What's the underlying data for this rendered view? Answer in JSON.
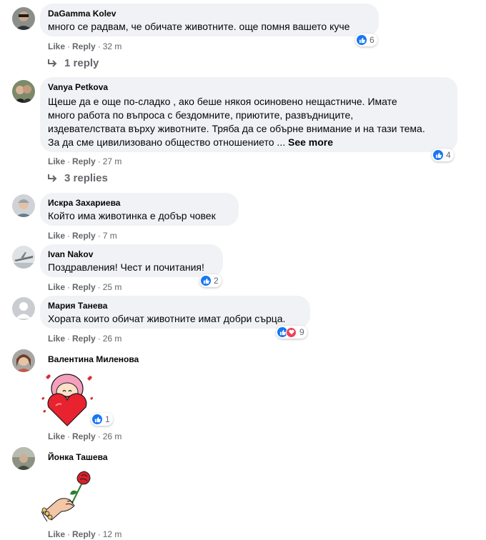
{
  "comments": [
    {
      "author": "DaGamma Kolev",
      "text": "много се радвам, че обичате животните. още помня вашето куче",
      "like": "Like",
      "reply": "Reply",
      "time": "32 m",
      "reactions": "6",
      "replies": "1 reply"
    },
    {
      "author": "Vanya Petkova",
      "lines": [
        "Щеше да е още по-сладко , ако беше някоя осиновено нещастниче. Имате",
        "много работа по въпроса с бездомните, приютите, развъдниците,",
        "издевателствата върху животните. Тряба да се обърне внимание и на тази тема.",
        "За да сме цивилизовано общество отношението ... "
      ],
      "see_more": "See more",
      "like": "Like",
      "reply": "Reply",
      "time": "27 m",
      "reactions": "4",
      "replies": "3 replies"
    },
    {
      "author": "Искра Захариева",
      "text": "Който има животинка е добър човек",
      "like": "Like",
      "reply": "Reply",
      "time": "7 m"
    },
    {
      "author": "Ivan Nakov",
      "text": "Поздравления! Чест и почитания!",
      "like": "Like",
      "reply": "Reply",
      "time": "25 m",
      "reactions": "2"
    },
    {
      "author": "Мария Танева",
      "text": "Хората които обичат животните имат добри сърца.",
      "like": "Like",
      "reply": "Reply",
      "time": "26 m",
      "reactions": "9"
    },
    {
      "author": "Валентина Миленова",
      "like": "Like",
      "reply": "Reply",
      "time": "26 m",
      "reactions": "1"
    },
    {
      "author": "Йонка Ташева",
      "like": "Like",
      "reply": "Reply",
      "time": "12 m"
    }
  ],
  "icons": {
    "like": "like-icon",
    "love": "love-icon",
    "reply_arrow": "reply-arrow-icon"
  },
  "colors": {
    "accent": "#1877f2",
    "love": "#f33e58",
    "bubble": "#f0f2f5",
    "meta": "#65676b"
  }
}
